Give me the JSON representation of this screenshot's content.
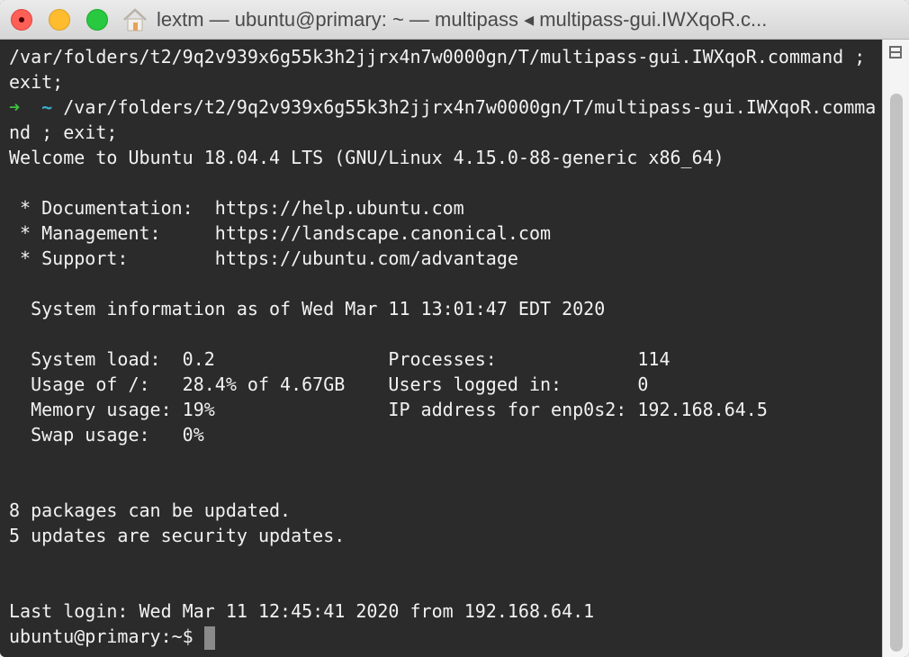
{
  "window": {
    "title": "lextm — ubuntu@primary: ~ — multipass ◂ multipass-gui.IWXqoR.c..."
  },
  "terminal": {
    "lines": [
      "/var/folders/t2/9q2v939x6g55k3h2jjrx4n7w0000gn/T/multipass-gui.IWXqoR.command ;",
      "exit;",
      "",
      "nd ; exit;",
      "Welcome to Ubuntu 18.04.4 LTS (GNU/Linux 4.15.0-88-generic x86_64)",
      "",
      " * Documentation:  https://help.ubuntu.com",
      " * Management:     https://landscape.canonical.com",
      " * Support:        https://ubuntu.com/advantage",
      "",
      "  System information as of Wed Mar 11 13:01:47 EDT 2020",
      "",
      "  System load:  0.2                Processes:             114",
      "  Usage of /:   28.4% of 4.67GB    Users logged in:       0",
      "  Memory usage: 19%                IP address for enp0s2: 192.168.64.5",
      "  Swap usage:   0%",
      "",
      "",
      "8 packages can be updated.",
      "5 updates are security updates.",
      "",
      "",
      "Last login: Wed Mar 11 12:45:41 2020 from 192.168.64.1"
    ],
    "prompt_arrow": "➜",
    "prompt_tilde": "~",
    "prompt_command": "/var/folders/t2/9q2v939x6g55k3h2jjrx4n7w0000gn/T/multipass-gui.IWXqoR.comma",
    "shell_prompt": "ubuntu@primary:~$"
  },
  "colors": {
    "background": "#2b2b2b",
    "arrow": "#3fc23f",
    "tilde": "#3bb0c9"
  }
}
